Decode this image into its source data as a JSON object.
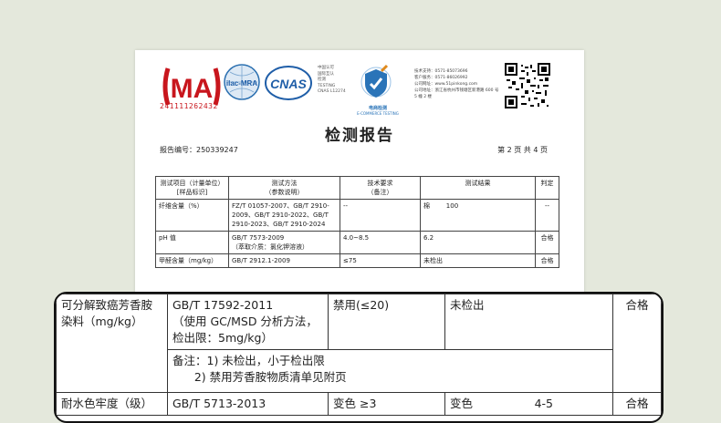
{
  "logos": {
    "cma_icon": "cma-logo",
    "cma_number": "241111262432",
    "ilac_icon": "ilac-mra-logo",
    "ilac_text": "ilac-MRA",
    "cnas_icon": "cnas-logo",
    "cnas_text": "CNAS",
    "cnas_note": [
      "中国认可",
      "国际互认",
      "检测",
      "TESTING",
      "CNAS L12274"
    ],
    "ecommerce_icon": "e-commerce-testing-badge",
    "ecommerce_label": "电商检测",
    "ecommerce_label_en": "E-COMMERCE TESTING",
    "qr_icon": "qr-code"
  },
  "contact": {
    "lines": [
      "技术支持：0571-85073696",
      "客户服务：0571-86026992",
      "公司网址：www.51pinkong.com",
      "公司地址：浙江省杭州市钱塘区新港路 600 号",
      "5 幢 2 楼"
    ]
  },
  "report": {
    "title": "检测报告",
    "report_no": "报告编号：250339247",
    "page_no": "第 2 页 共 4 页"
  },
  "table_small": {
    "headers": [
      "测试项目（计量单位）\n[样品标识]",
      "测试方法\n（参数说明）",
      "技术要求\n（备注）",
      "测试结果",
      "判定"
    ],
    "rows": [
      [
        "纤维含量（%）",
        "FZ/T 01057-2007、GB/T 2910-2009、GB/T 2910-2022、GB/T 2910-2023、GB/T 2910-2024",
        "--",
        "棉        100",
        "--"
      ],
      [
        "pH 值",
        "GB/T 7573-2009\n（萃取介质：氯化钾溶液）",
        "4.0~8.5",
        "6.2",
        "合格"
      ],
      [
        "甲醛含量（mg/kg）",
        "GB/T 2912.1-2009",
        "≤75",
        "未检出",
        "合格"
      ]
    ]
  },
  "table_zoom": {
    "row1": {
      "item": "可分解致癌芳香胺染料（mg/kg）",
      "method": "GB/T 17592-2011\n（使用 GC/MSD 分析方法，检出限：5mg/kg）",
      "requirement": "禁用(≤20)",
      "result": "未检出",
      "verdict": "合格",
      "note": "备注：1) 未检出，小于检出限\n      2) 禁用芳香胺物质清单见附页"
    },
    "row2": {
      "item": "耐水色牢度（级）",
      "method": "GB/T 5713-2013",
      "requirement": "变色  ≥3",
      "result_label": "变色",
      "result_value": "4-5",
      "verdict": "合格"
    }
  }
}
